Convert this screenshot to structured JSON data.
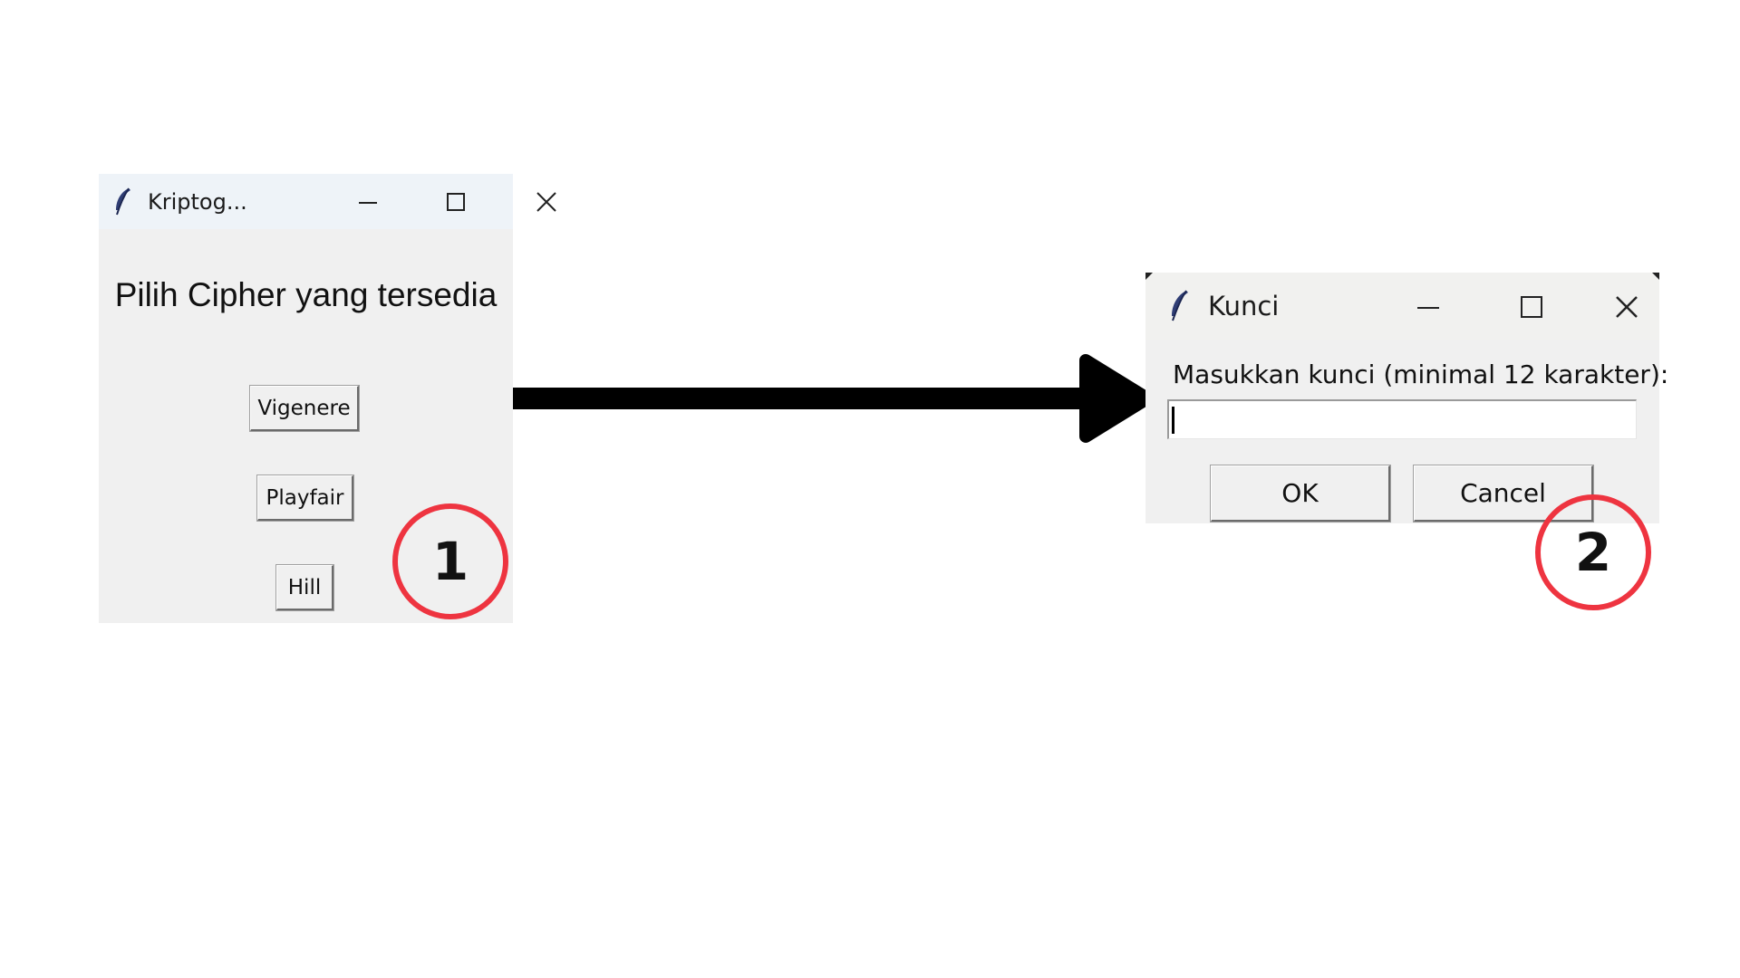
{
  "window1": {
    "title": "Kriptog...",
    "heading": "Pilih Cipher yang tersedia",
    "buttons": [
      "Vigenere",
      "Playfair",
      "Hill"
    ]
  },
  "window2": {
    "title": "Kunci",
    "prompt": "Masukkan kunci (minimal 12 karakter):",
    "key_value": "",
    "ok_label": "OK",
    "cancel_label": "Cancel"
  },
  "annotations": {
    "step1": "1",
    "step2": "2",
    "colors": {
      "circle": "#ee3440",
      "arrow": "#000000"
    }
  },
  "icons": {
    "app": "feather-icon",
    "minimize": "minimize-icon",
    "maximize": "maximize-icon",
    "close": "close-icon",
    "flow_arrow": "arrow-right-icon"
  }
}
